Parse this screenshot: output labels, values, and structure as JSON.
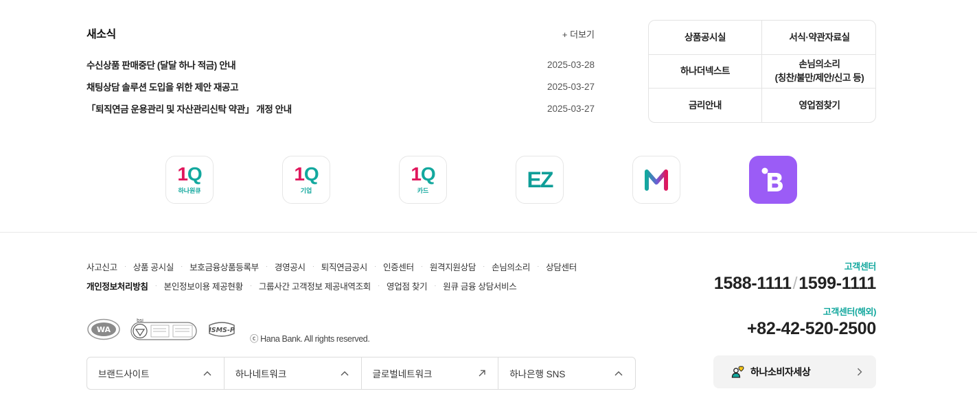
{
  "news": {
    "title": "새소식",
    "more": "+ 더보기",
    "items": [
      {
        "text": "수신상품 판매중단 (달달 하나 적금) 안내",
        "date": "2025-03-28"
      },
      {
        "text": "채팅상담 솔루션 도입을 위한 제안 재공고",
        "date": "2025-03-27"
      },
      {
        "text": "「퇴직연금 운용관리 및 자산관리신탁 약관」 개정 안내",
        "date": "2025-03-27"
      }
    ]
  },
  "quick": [
    "상품공시실",
    "서식·약관자료실",
    "하나더넥스트",
    "손님의소리\n(칭찬/불만/제안/신고 등)",
    "금리안내",
    "영업점찾기"
  ],
  "apps": {
    "hana_1q": {
      "logo_a": "1",
      "logo_b": "Q",
      "sub": "하나원큐"
    },
    "corp_1q": {
      "logo_a": "1",
      "logo_b": "Q",
      "sub": "기업"
    },
    "card_1q": {
      "logo_a": "1",
      "logo_b": "Q",
      "sub": "카드"
    },
    "ez": {
      "logo": "EZ"
    },
    "m": {},
    "b": {}
  },
  "footer": {
    "row1": [
      "사고신고",
      "상품 공시실",
      "보호금융상품등록부",
      "경영공시",
      "퇴직연금공시",
      "인증센터",
      "원격지원상담",
      "손님의소리",
      "상담센터"
    ],
    "row2": [
      "개인정보처리방침",
      "본인정보이용 제공현황",
      "그룹사간 고객정보 제공내역조회",
      "영업점 찾기",
      "원큐 금융 상담서비스"
    ],
    "copyright": "ⓒ Hana Bank. All rights reserved.",
    "selectors": [
      {
        "label": "브랜드사이트",
        "icon": "chevron-up-icon"
      },
      {
        "label": "하나네트워크",
        "icon": "chevron-up-icon"
      },
      {
        "label": "글로벌네트워크",
        "icon": "external-arrow-icon"
      },
      {
        "label": "하나은행 SNS",
        "icon": "chevron-up-icon"
      }
    ]
  },
  "contact": {
    "label1": "고객센터",
    "num1a": "1588-1111",
    "sep": "/",
    "num1b": "1599-1111",
    "label2": "고객센터(해외)",
    "num2": "+82-42-520-2500",
    "consumer": "하나소비자세상"
  },
  "colors": {
    "accent": "#13a89e",
    "brand_red": "#e0175c",
    "purple": "#9b5cf6"
  }
}
